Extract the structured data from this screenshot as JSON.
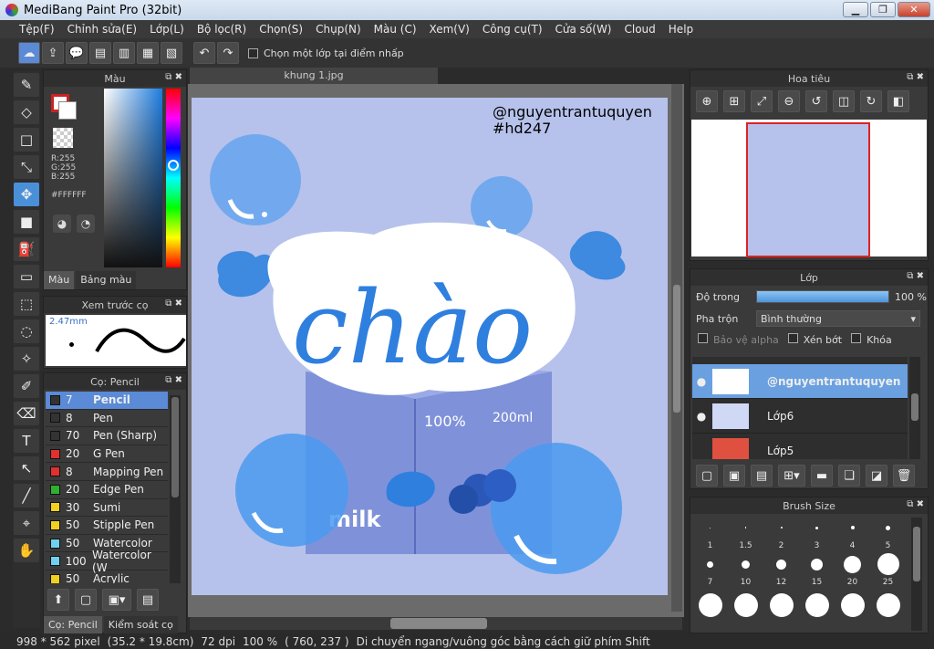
{
  "window": {
    "title": "MediBang Paint Pro (32bit)"
  },
  "menu": [
    "Tệp(F)",
    "Chỉnh sửa(E)",
    "Lớp(L)",
    "Bộ lọc(R)",
    "Chọn(S)",
    "Chụp(N)",
    "Màu (C)",
    "Xem(V)",
    "Công cụ(T)",
    "Cửa số(W)",
    "Cloud",
    "Help"
  ],
  "toolbar": {
    "option_label": "Chọn một lớp tại điểm nhấp"
  },
  "color_panel": {
    "title": "Màu",
    "r": "R:255",
    "g": "G:255",
    "b": "B:255",
    "hex": "#FFFFFF",
    "tab_color": "Màu",
    "tab_palette": "Bảng màu",
    "primary": "#ffffff",
    "secondary": "#cc2222"
  },
  "preview_panel": {
    "title": "Xem trước cọ",
    "size": "2.47mm"
  },
  "brush_panel": {
    "title": "Cọ: Pencil",
    "items": [
      {
        "size": "7",
        "name": "Pencil",
        "color": "#333333"
      },
      {
        "size": "8",
        "name": "Pen",
        "color": "#333333"
      },
      {
        "size": "70",
        "name": "Pen (Sharp)",
        "color": "#333333"
      },
      {
        "size": "20",
        "name": "G Pen",
        "color": "#e03030"
      },
      {
        "size": "8",
        "name": "Mapping Pen",
        "color": "#e03030"
      },
      {
        "size": "20",
        "name": "Edge Pen",
        "color": "#30b030"
      },
      {
        "size": "30",
        "name": "Sumi",
        "color": "#f0d020"
      },
      {
        "size": "50",
        "name": "Stipple Pen",
        "color": "#f0d020"
      },
      {
        "size": "50",
        "name": "Watercolor",
        "color": "#70d0f0"
      },
      {
        "size": "100",
        "name": "Watercolor (W",
        "color": "#70d0f0"
      },
      {
        "size": "50",
        "name": "Acrylic",
        "color": "#f0d020"
      }
    ],
    "tab_brush": "Cọ: Pencil",
    "tab_control": "Kiểm soát cọ"
  },
  "canvas": {
    "tab": "khung 1.jpg",
    "watermark_1": "@nguyentrantuquyen",
    "watermark_2": "#hd247",
    "word": "chào",
    "milk": "milk",
    "percent": "100%",
    "ml": "200ml"
  },
  "navigator": {
    "title": "Hoa tiêu"
  },
  "layer_panel": {
    "title": "Lớp",
    "opacity_label": "Độ trong",
    "opacity_value": "100 %",
    "opacity": 1.0,
    "blend_label": "Pha trộn",
    "blend_value": "Bình thường",
    "protect_alpha": "Bảo vệ alpha",
    "clipping": "Xén bớt",
    "lock": "Khóa",
    "layers": [
      {
        "name": "@nguyentrantuquyen",
        "selected": true
      },
      {
        "name": "Lớp6",
        "selected": false
      },
      {
        "name": "Lớp5",
        "selected": false
      }
    ]
  },
  "brushsize_panel": {
    "title": "Brush Size",
    "sizes": [
      "1",
      "1.5",
      "2",
      "3",
      "4",
      "5",
      "7",
      "10",
      "12",
      "15",
      "20",
      "25"
    ]
  },
  "status": {
    "dims": "998 * 562 pixel",
    "physical": "(35.2 * 19.8cm)",
    "dpi": "72 dpi",
    "zoom": "100 %",
    "coords": "( 760, 237 )",
    "hint": "Di chuyển ngang/vuông góc bằng cách giữ phím Shift"
  }
}
